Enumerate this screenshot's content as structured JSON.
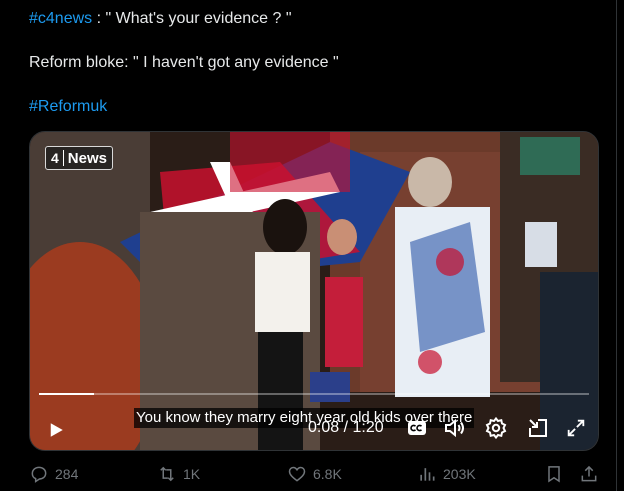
{
  "tweet": {
    "line1_hashtag": "#c4news",
    "line1_rest": " : \" What's your evidence ? \"",
    "line2": "Reform bloke: \" I haven't got any evidence \"",
    "line3_hashtag": "#Reformuk"
  },
  "video": {
    "badge_number": "4",
    "badge_label": "News",
    "subtitle": "You know they marry eight year old kids over there",
    "time": "0:08 / 1:20",
    "progress": 0.1
  },
  "actions": {
    "replies": "284",
    "reposts": "1K",
    "likes": "6.8K",
    "views": "203K"
  },
  "icons": [
    "play-icon",
    "closed-captions-icon",
    "volume-icon",
    "settings-icon",
    "picture-in-picture-icon",
    "fullscreen-icon",
    "reply-icon",
    "repost-icon",
    "like-icon",
    "views-icon",
    "bookmark-icon",
    "share-icon"
  ]
}
